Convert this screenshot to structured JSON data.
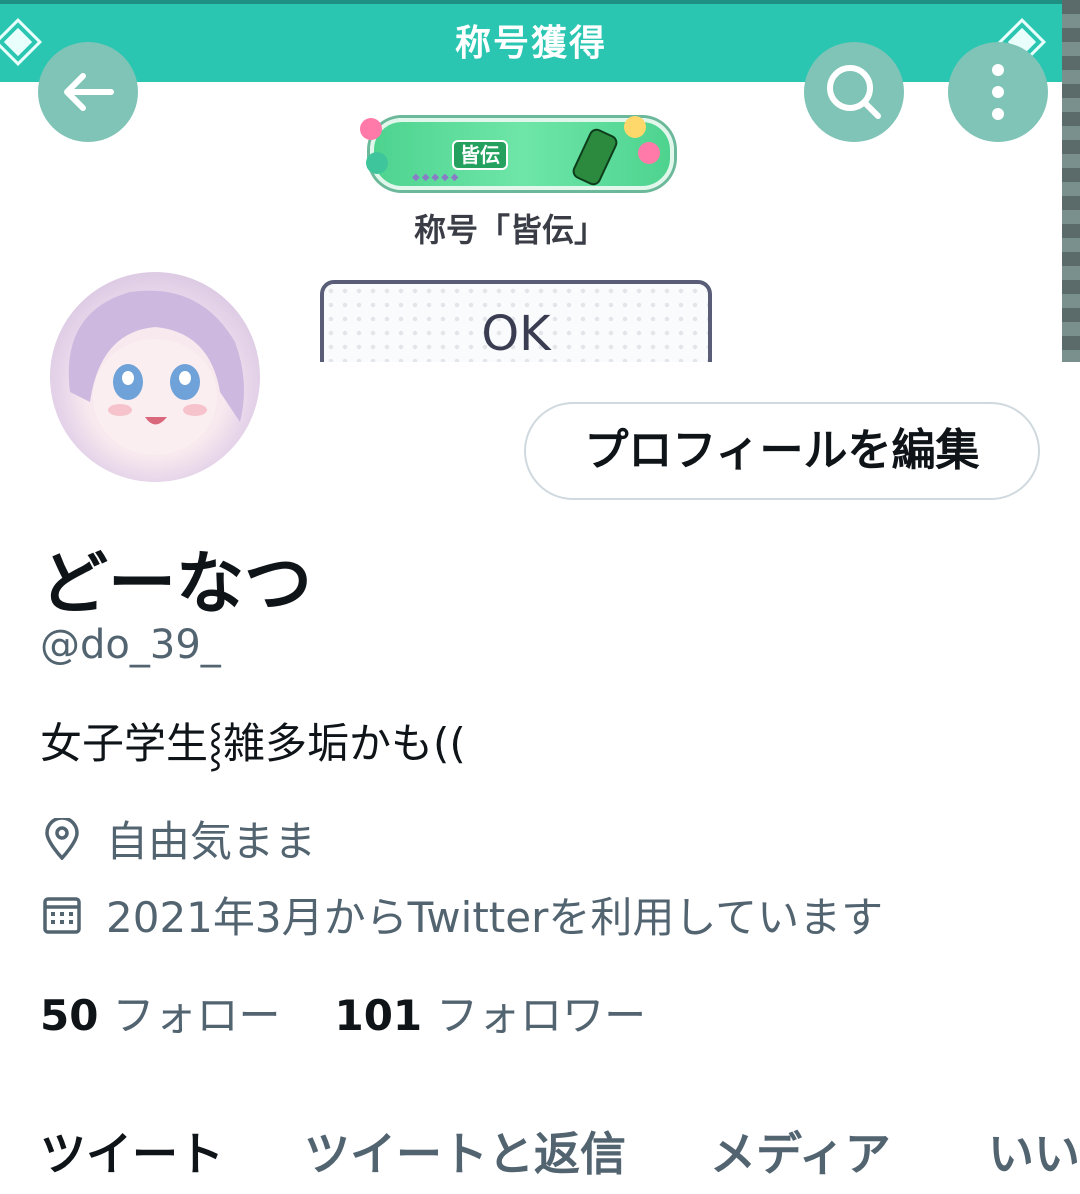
{
  "overlay": {
    "title": "称号獲得",
    "badge_label": "皆伝",
    "caption": "称号「皆伝」",
    "ok_label": "OK"
  },
  "profile": {
    "edit_label": "プロフィールを編集",
    "name": "どーなつ",
    "handle": "@do_39_",
    "bio": "女子学生⸾雑多垢かも((",
    "location": "自由気まま",
    "joined": "2021年3月からTwitterを利用しています",
    "following_count": "50",
    "following_label": "フォロー",
    "followers_count": "101",
    "followers_label": "フォロワー"
  },
  "tabs": [
    "ツイート",
    "ツイートと返信",
    "メディア",
    "いい"
  ],
  "colors": {
    "overlay_bar": "#2bc6b2",
    "text_secondary": "#536471",
    "circle_button": "#7fc4b7"
  },
  "icons": [
    "back-arrow-icon",
    "search-icon",
    "more-vertical-icon",
    "location-pin-icon",
    "calendar-icon"
  ]
}
